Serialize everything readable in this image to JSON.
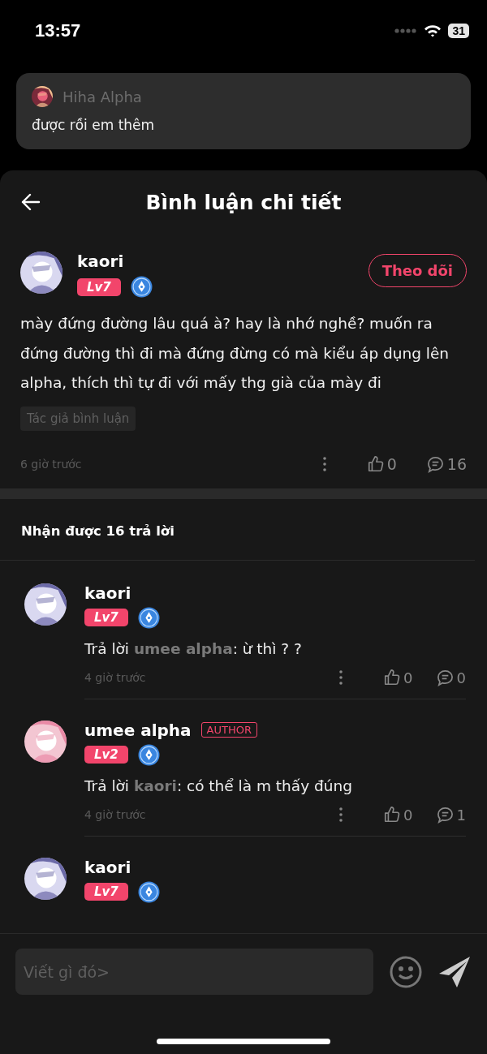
{
  "status_bar": {
    "time": "13:57",
    "battery": "31"
  },
  "notification": {
    "sender": "Hiha Alpha",
    "message": "được rồi em thêm"
  },
  "header": {
    "title": "Bình luận chi tiết"
  },
  "comment": {
    "author": "kaori",
    "level": "Lv7",
    "follow_label": "Theo dõi",
    "text": "mày đứng đường lâu quá à? hay là nhớ nghề? muốn ra đứng đường thì đi mà đứng đừng có mà kiểu áp dụng lên alpha, thích thì tự đi với mấy thg già của mày đi",
    "tag": "Tác giả bình luận",
    "time": "6 giờ trước",
    "likes": "0",
    "replies": "16"
  },
  "replies_heading": "Nhận được 16 trả lời",
  "replies": [
    {
      "author": "kaori",
      "is_author": false,
      "level": "Lv7",
      "reply_prefix": "Trả lời",
      "reply_to": "umee alpha",
      "text": ": ừ  thì ? ?",
      "time": "4 giờ trước",
      "likes": "0",
      "comments": "0"
    },
    {
      "author": "umee alpha",
      "is_author": true,
      "author_badge": "AUTHOR",
      "level": "Lv2",
      "reply_prefix": "Trả lời",
      "reply_to": "kaori",
      "text": ": có thể là m thấy đúng",
      "time": "4 giờ trước",
      "likes": "0",
      "comments": "1"
    },
    {
      "author": "kaori",
      "is_author": false,
      "level": "Lv7"
    }
  ],
  "composer": {
    "placeholder": "Viết gì đó>"
  }
}
